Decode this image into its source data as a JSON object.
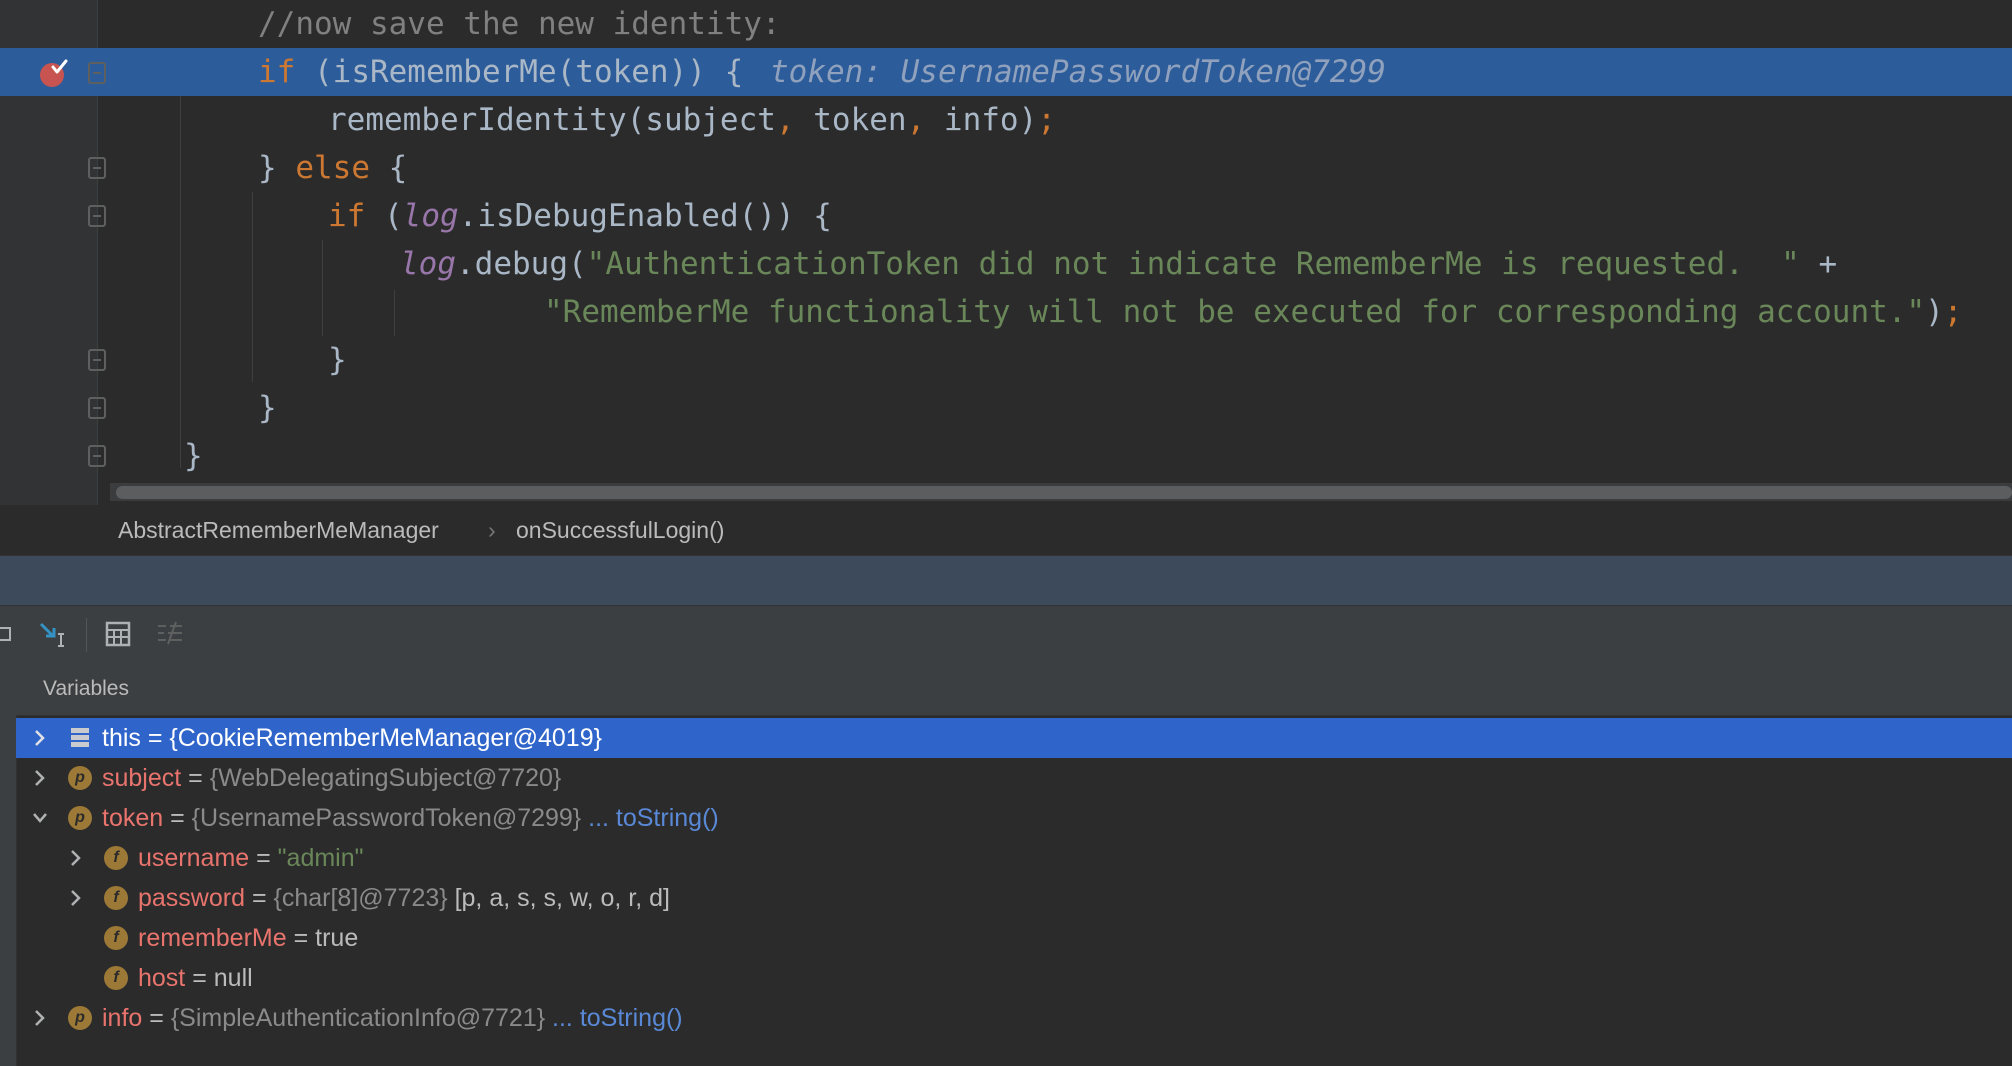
{
  "editor": {
    "lines": [
      {
        "comment": "//now save the new identity:"
      },
      {
        "kw_if": "if",
        "code": " (isRememberMe(token)) {",
        "hint": "token: UsernamePasswordToken@7299"
      },
      {
        "code_a": "rememberIdentity(subject",
        "sep1": ",",
        "code_b": " token",
        "sep2": ",",
        "code_c": " info)",
        "semi": ";"
      },
      {
        "brace": "} ",
        "kw_else": "else",
        "brace2": " {"
      },
      {
        "kw_if": "if",
        "paren": " (",
        "logv": "log",
        "code": ".isDebugEnabled()) {"
      },
      {
        "logv": "log",
        "call": ".debug(",
        "str": "\"AuthenticationToken did not indicate RememberMe is requested.  \"",
        "plus": " +"
      },
      {
        "str": "\"RememberMe functionality will not be executed for corresponding account.\"",
        "close": ")",
        "semi": ";"
      },
      {
        "code": "}"
      },
      {
        "code": "}"
      },
      {
        "code": "}"
      }
    ]
  },
  "breadcrumb": {
    "class_name": "AbstractRememberMeManager",
    "separator": "›",
    "method_name": "onSuccessfulLogin()"
  },
  "variables": {
    "title": "Variables",
    "rows": [
      {
        "name": "this",
        "eq": " = ",
        "value": "{CookieRememberMeManager@4019}",
        "badge": ""
      },
      {
        "name": "subject",
        "eq": " = ",
        "value": "{WebDelegatingSubject@7720}",
        "badge": "p"
      },
      {
        "name": "token",
        "eq": " = ",
        "value": "{UsernamePasswordToken@7299}",
        "link": "... toString()",
        "badge": "p"
      },
      {
        "name": "username",
        "eq": " = ",
        "value": "\"admin\"",
        "badge": "f"
      },
      {
        "name": "password",
        "eq": " = ",
        "value": "{char[8]@7723}",
        "extra": "[p, a, s, s, w, o, r, d]",
        "badge": "f"
      },
      {
        "name": "rememberMe",
        "eq": " = ",
        "value": "true",
        "badge": "f"
      },
      {
        "name": "host",
        "eq": " = ",
        "value": "null",
        "badge": "f"
      },
      {
        "name": "info",
        "eq": " = ",
        "value": "{SimpleAuthenticationInfo@7721}",
        "link": "... toString()",
        "badge": "p"
      }
    ]
  },
  "colors": {
    "current_line": "#2D5C9A",
    "selected_row": "#2F65CA",
    "keyword": "#CC7832",
    "string": "#6A8759",
    "var_name": "#E8746D"
  }
}
